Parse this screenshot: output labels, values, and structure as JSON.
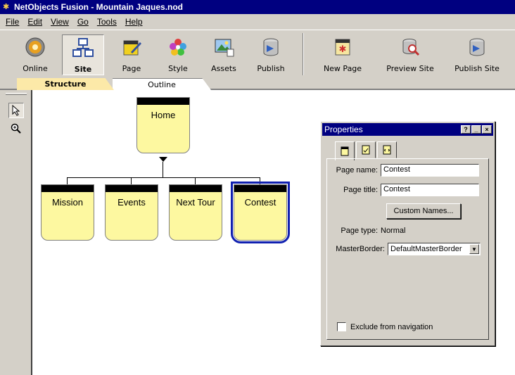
{
  "window": {
    "title": "NetObjects Fusion - Mountain Jaques.nod"
  },
  "menu": [
    "File",
    "Edit",
    "View",
    "Go",
    "Tools",
    "Help"
  ],
  "toolbar": {
    "buttons": [
      {
        "label": "Online",
        "icon": "online-icon"
      },
      {
        "label": "Site",
        "icon": "site-icon"
      },
      {
        "label": "Page",
        "icon": "page-icon"
      },
      {
        "label": "Style",
        "icon": "style-icon"
      },
      {
        "label": "Assets",
        "icon": "assets-icon"
      },
      {
        "label": "Publish",
        "icon": "publish-icon"
      },
      {
        "label": "New Page",
        "icon": "new-page-icon"
      },
      {
        "label": "Preview Site",
        "icon": "preview-site-icon"
      },
      {
        "label": "Publish Site",
        "icon": "publish-site-icon"
      }
    ],
    "active": "Site"
  },
  "view_tabs": {
    "structure": "Structure",
    "outline": "Outline",
    "active": "Structure"
  },
  "site_tree": {
    "root": "Home",
    "children": [
      "Mission",
      "Events",
      "Next Tour",
      "Contest"
    ],
    "selected": "Contest"
  },
  "properties": {
    "title": "Properties",
    "page_name_label": "Page name:",
    "page_name_value": "Contest",
    "page_title_label": "Page title:",
    "page_title_value": "Contest",
    "custom_names_button": "Custom Names...",
    "page_type_label": "Page type:",
    "page_type_value": "Normal",
    "masterborder_label": "MasterBorder:",
    "masterborder_value": "DefaultMasterBorder",
    "exclude_label": "Exclude from navigation",
    "exclude_checked": false
  },
  "colors": {
    "titlebar": "#000080",
    "page_node": "#fdf8a0",
    "selection": "#1020b0",
    "structure_tab": "#fce9a8"
  }
}
